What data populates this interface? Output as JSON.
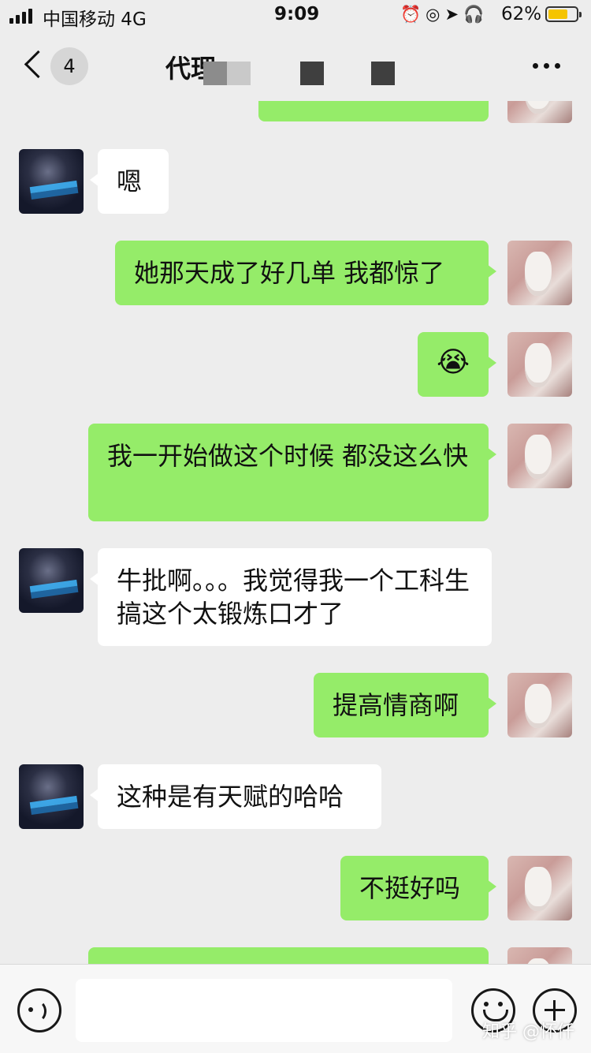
{
  "status_bar": {
    "carrier": "中国移动 4G",
    "time": "9:09",
    "status_icons": "⏰◎➤🎧",
    "battery": "62%",
    "battery_color": "#f5c400"
  },
  "nav": {
    "back_count": "4",
    "title": "代理",
    "more_icon": "more-dots-icon"
  },
  "colors": {
    "outgoing_bubble": "#95ec69",
    "incoming_bubble": "#ffffff",
    "background": "#ededed"
  },
  "messages": [
    {
      "side": "out",
      "text": "",
      "partial": true
    },
    {
      "side": "in",
      "text": "嗯"
    },
    {
      "side": "out",
      "text": "她那天成了好几单 我都惊了"
    },
    {
      "side": "out",
      "text": "😭",
      "emoji": "tears-of-joy-emoji"
    },
    {
      "side": "out",
      "text": "我一开始做这个时候 都没这么快"
    },
    {
      "side": "in",
      "text": "牛批啊。。。我觉得我一个工科生搞这个太锻炼口才了"
    },
    {
      "side": "out",
      "text": "提高情商啊"
    },
    {
      "side": "in",
      "text": "这种是有天赋的哈哈"
    },
    {
      "side": "out",
      "text": "不挺好吗"
    },
    {
      "side": "out",
      "text": "",
      "partial": true
    }
  ],
  "input_bar": {
    "voice_icon": "voice-icon",
    "input_value": "",
    "emoji_icon": "emoji-icon",
    "plus_icon": "plus-icon"
  },
  "watermark": "知乎 @怀仟"
}
